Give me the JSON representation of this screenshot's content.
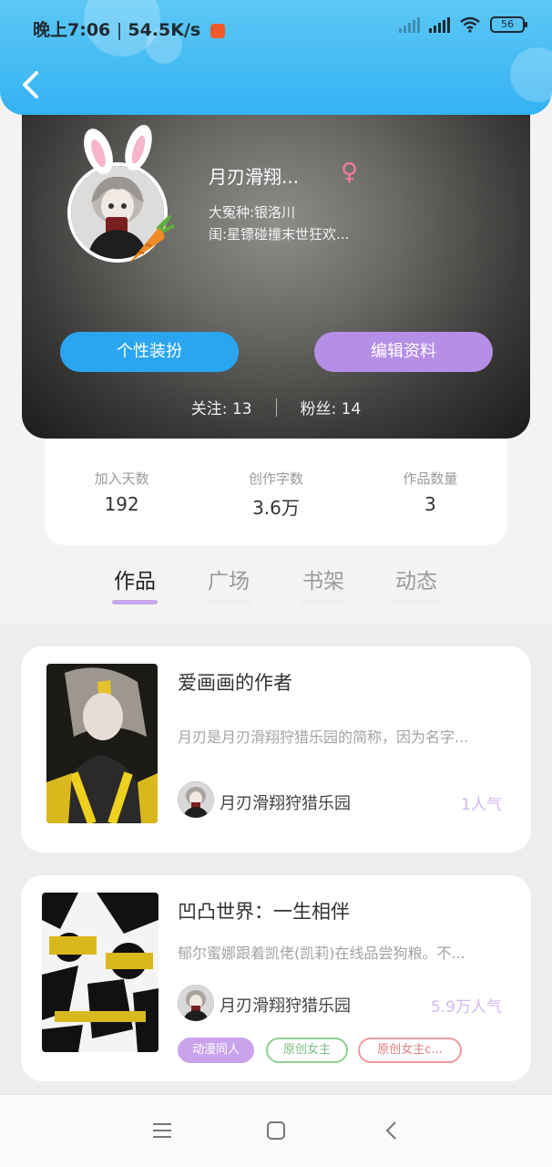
{
  "status": {
    "time": "晚上7:06",
    "speed": "54.5K/s",
    "battery": "56"
  },
  "profile": {
    "nickname": "月刃滑翔...",
    "gender_symbol": "♀",
    "line1": "大冤种:银洛川",
    "line2": "闺:星镖碰撞末世狂欢...",
    "btn_dress": "个性装扮",
    "btn_edit": "编辑资料",
    "following": "关注: 13",
    "fans": "粉丝: 14"
  },
  "stats": [
    {
      "label": "加入天数",
      "value": "192"
    },
    {
      "label": "创作字数",
      "value": "3.6万"
    },
    {
      "label": "作品数量",
      "value": "3"
    }
  ],
  "tabs": [
    {
      "label": "作品",
      "active": true
    },
    {
      "label": "广场",
      "active": false
    },
    {
      "label": "书架",
      "active": false
    },
    {
      "label": "动态",
      "active": false
    }
  ],
  "works": [
    {
      "title": "爱画画的作者",
      "desc": "月刃是月刃滑翔狩猎乐园的简称，因为名字...",
      "author": "月刃滑翔狩猎乐园",
      "popularity": "1人气"
    },
    {
      "title": "凹凸世界：一生相伴",
      "desc": "郁尔蜜娜跟着凯佬(凯莉)在线品尝狗粮。不...",
      "author": "月刃滑翔狩猎乐园",
      "popularity": "5.9万人气",
      "tags": [
        "动漫同人",
        "原创女主",
        "原创女主c..."
      ]
    }
  ],
  "colors": {
    "header_blue": "#35b2f3",
    "accent_purple": "#b58ee6",
    "accent_blue": "#2aa6f1"
  }
}
